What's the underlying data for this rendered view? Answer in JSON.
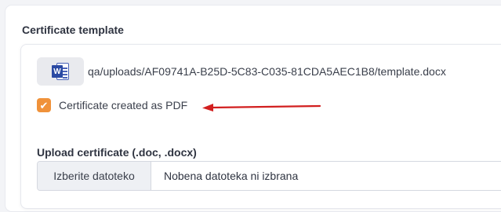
{
  "section": {
    "title": "Certificate template"
  },
  "file": {
    "icon": "word-doc-icon",
    "icon_letter": "W",
    "path": "qa/uploads/AF09741A-B25D-5C83-C035-81CDA5AEC1B8/template.docx"
  },
  "pdf_option": {
    "label": "Certificate created as PDF",
    "checked": true,
    "check_glyph": "✔"
  },
  "upload": {
    "label": "Upload certificate (.doc, .docx)",
    "button_label": "Izberite datoteko",
    "status": "Nobena datoteka ni izbrana"
  },
  "colors": {
    "accent_orange": "#f0923a",
    "annotation_red": "#d21f1f",
    "word_blue": "#2b4aa3"
  }
}
